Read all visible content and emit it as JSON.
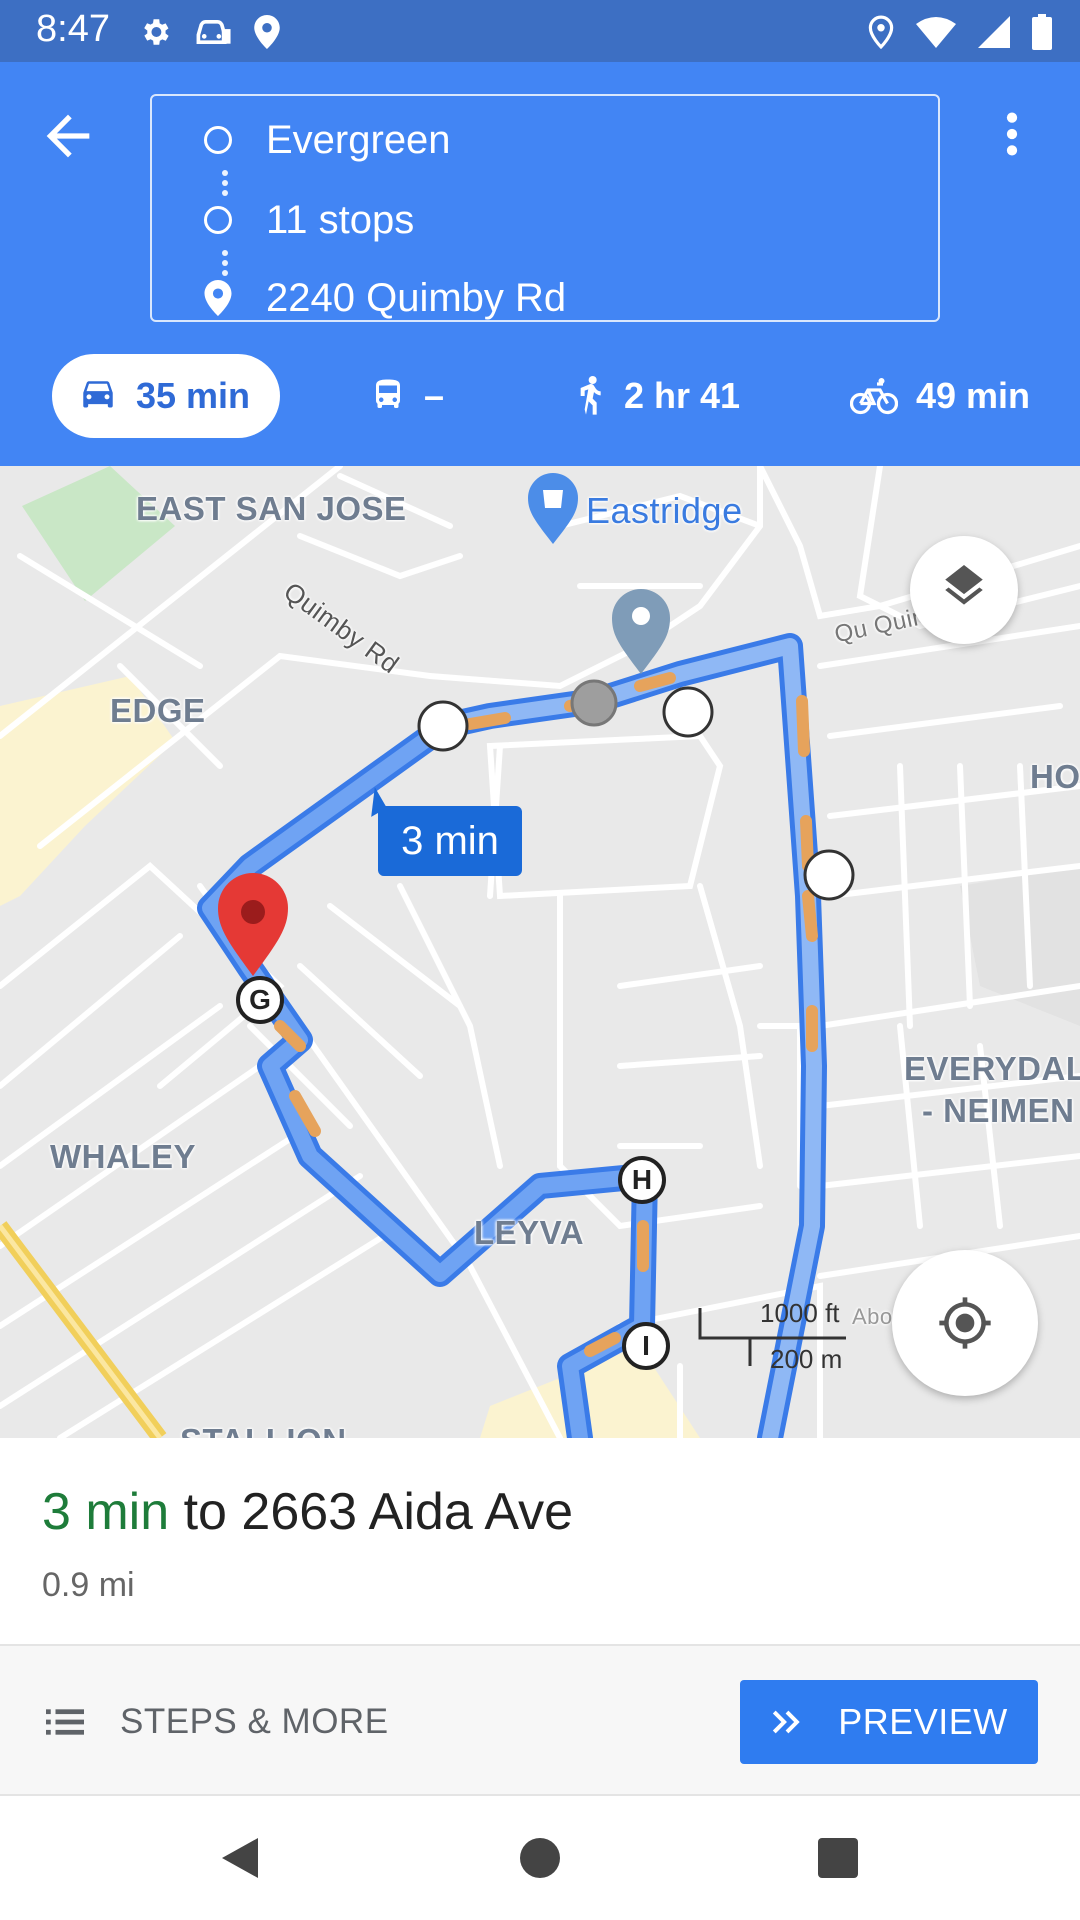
{
  "status_bar": {
    "time": "8:47",
    "left_icons": [
      "gear-icon",
      "car-icon",
      "location-icon"
    ],
    "right_icons": [
      "location-icon",
      "wifi-icon",
      "signal-icon",
      "battery-icon"
    ]
  },
  "header": {
    "origin": "Evergreen",
    "stops": "11 stops",
    "destination": "2240 Quimby Rd",
    "modes": [
      {
        "icon": "car-icon",
        "label": "35 min",
        "active": true
      },
      {
        "icon": "bus-icon",
        "label": "–",
        "active": false
      },
      {
        "icon": "walk-icon",
        "label": "2 hr 41",
        "active": false
      },
      {
        "icon": "bike-icon",
        "label": "49 min",
        "active": false
      }
    ]
  },
  "map": {
    "labels": {
      "east_san_jose": "EAST SAN JOSE",
      "eastridge": "Eastridge",
      "quimby_rd": "Quimby Rd",
      "qui_quin": "Qu Quin",
      "edge": "EDGE",
      "ho": "HO",
      "everydal": "EVERYDAL",
      "neimen": "- NEIMEN",
      "whaley": "WHALEY",
      "leyva": "LEYVA",
      "stallion": "STALLION",
      "abo": "Abo"
    },
    "route_time_chip": "3 min",
    "stop_markers": [
      "G",
      "H",
      "I"
    ],
    "scale": {
      "imperial": "1000 ft",
      "metric": "200 m"
    },
    "colors": {
      "route": "#4a8cf0",
      "route_light": "#8fb8f5",
      "traffic": "#e6a35c",
      "pin": "#e53935"
    }
  },
  "bottom_card": {
    "eta": "3 min",
    "to_text": " to 2663 Aida Ave",
    "distance": "0.9 mi"
  },
  "actions": {
    "steps_label": "STEPS & MORE",
    "preview_label": "PREVIEW"
  }
}
